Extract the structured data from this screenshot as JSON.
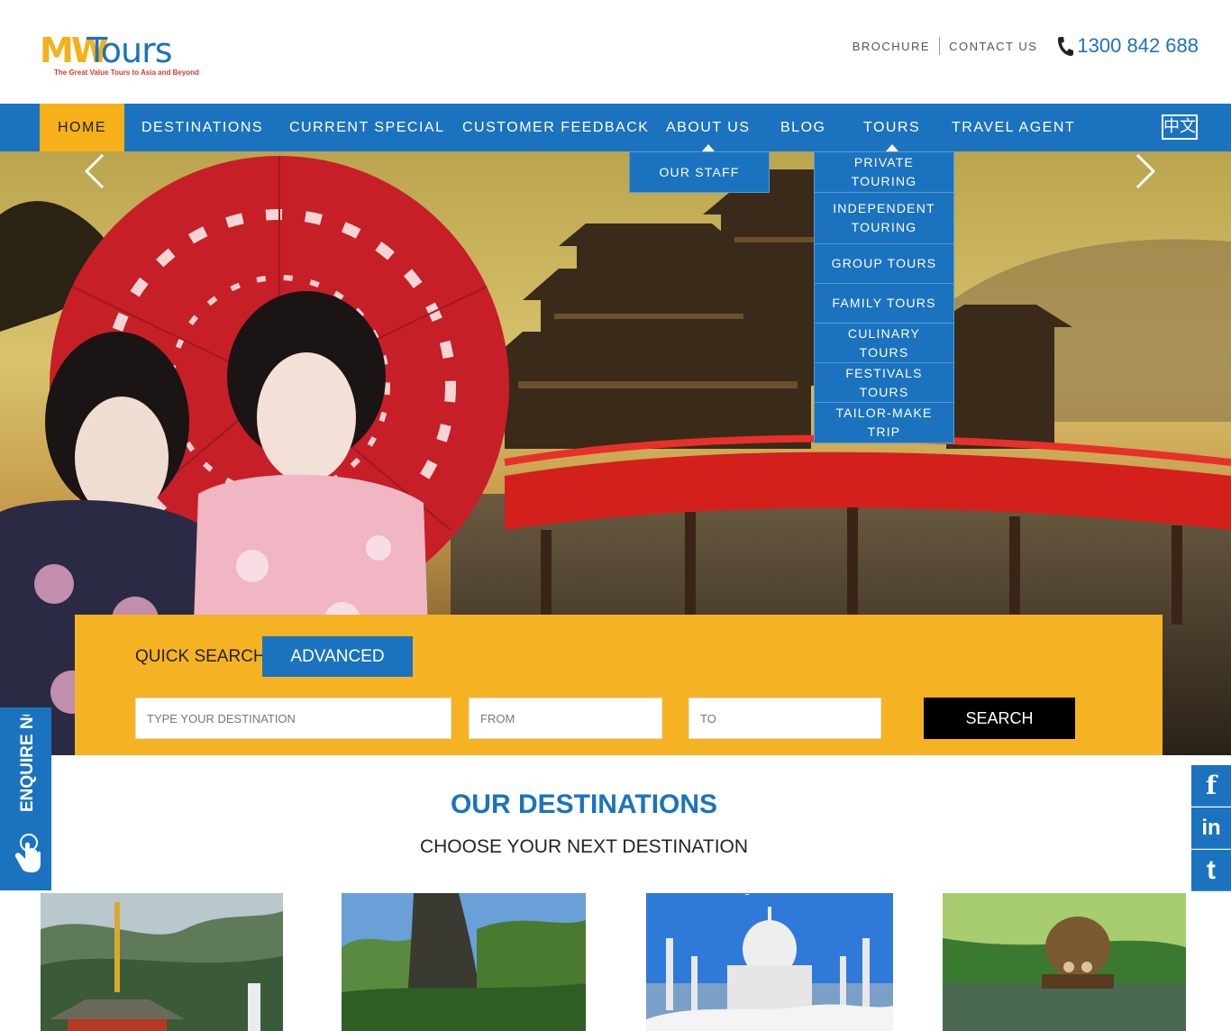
{
  "brand": {
    "logo_mw": "MW",
    "logo_tours": "Tours",
    "tagline": "The Great Value Tours to Asia and Beyond"
  },
  "top_links": {
    "brochure": "BROCHURE",
    "contact": "CONTACT US",
    "phone": "1300 842 688"
  },
  "nav": {
    "home": "HOME",
    "destinations": "DESTINATIONS",
    "current_special": "CURRENT SPECIAL",
    "customer_feedback": "CUSTOMER FEEDBACK",
    "about_us": "ABOUT US",
    "blog": "BLOG",
    "tours": "TOURS",
    "travel_agent": "TRAVEL AGENT",
    "language": "中文"
  },
  "about_menu": [
    "OUR STAFF"
  ],
  "tours_menu": [
    "PRIVATE TOURING",
    "INDEPENDENT TOURING",
    "GROUP TOURS",
    "FAMILY TOURS",
    "CULINARY TOURS",
    "FESTIVALS TOURS",
    "TAILOR-MAKE TRIP"
  ],
  "search": {
    "quick_label": "QUICK SEARCH",
    "advanced_label": "ADVANCED",
    "destination_placeholder": "TYPE YOUR DESTINATION",
    "from_placeholder": "FROM",
    "to_placeholder": "TO",
    "search_label": "SEARCH"
  },
  "enquire": {
    "label": "ENQUIRE NOW"
  },
  "social": {
    "facebook": "f",
    "linkedin": "in",
    "twitter": "t"
  },
  "destinations": {
    "title": "OUR DESTINATIONS",
    "subtitle": "CHOOSE YOUR NEXT DESTINATION"
  },
  "colors": {
    "brand_blue": "#1b73bf",
    "brand_yellow": "#f5b01a",
    "search_button": "#000000"
  }
}
